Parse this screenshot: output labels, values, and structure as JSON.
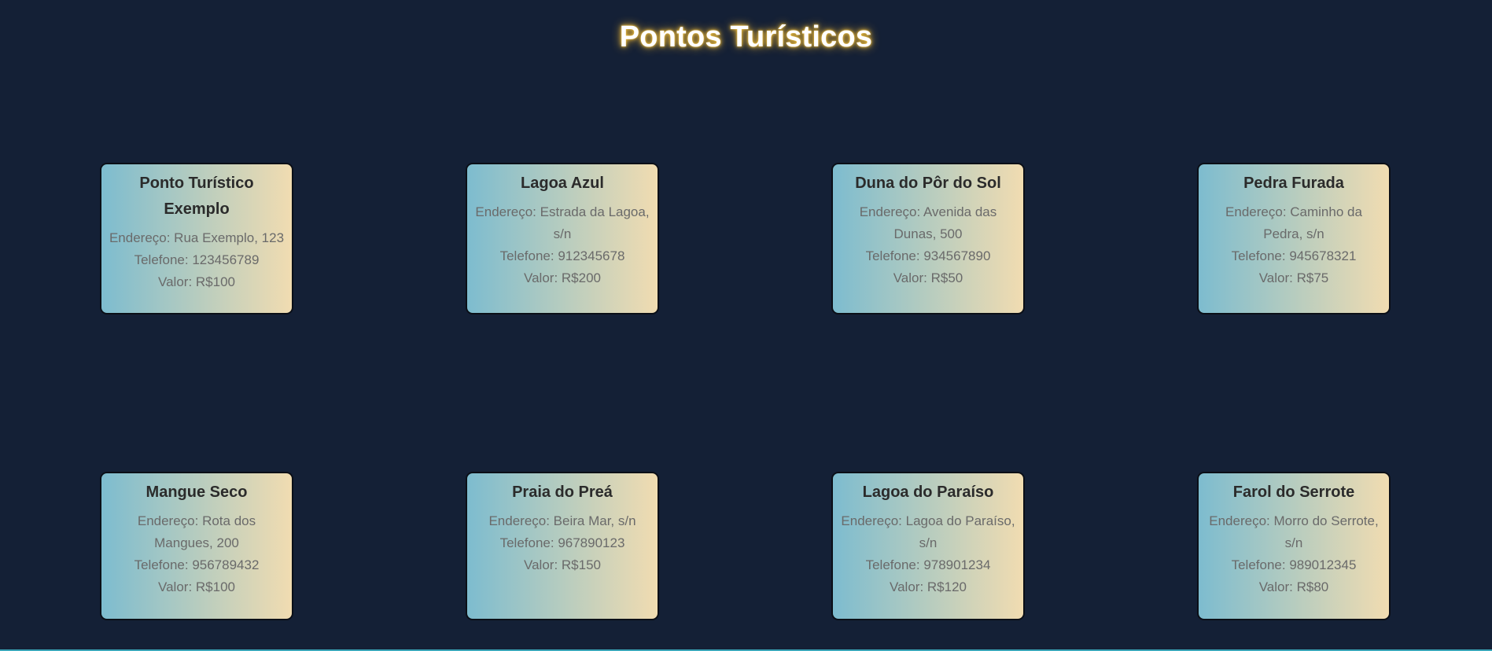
{
  "page": {
    "title": "Pontos Turísticos"
  },
  "cards": [
    {
      "name": "Ponto Turístico Exemplo",
      "address": "Endereço: Rua Exemplo, 123",
      "phone": "Telefone: 123456789",
      "price": "Valor: R$100"
    },
    {
      "name": "Lagoa Azul",
      "address": "Endereço: Estrada da Lagoa, s/n",
      "phone": "Telefone: 912345678",
      "price": "Valor: R$200"
    },
    {
      "name": "Duna do Pôr do Sol",
      "address": "Endereço: Avenida das Dunas, 500",
      "phone": "Telefone: 934567890",
      "price": "Valor: R$50"
    },
    {
      "name": "Pedra Furada",
      "address": "Endereço: Caminho da Pedra, s/n",
      "phone": "Telefone: 945678321",
      "price": "Valor: R$75"
    },
    {
      "name": "Mangue Seco",
      "address": "Endereço: Rota dos Mangues, 200",
      "phone": "Telefone: 956789432",
      "price": "Valor: R$100"
    },
    {
      "name": "Praia do Preá",
      "address": "Endereço: Beira Mar, s/n",
      "phone": "Telefone: 967890123",
      "price": "Valor: R$150"
    },
    {
      "name": "Lagoa do Paraíso",
      "address": "Endereço: Lagoa do Paraíso, s/n",
      "phone": "Telefone: 978901234",
      "price": "Valor: R$120"
    },
    {
      "name": "Farol do Serrote",
      "address": "Endereço: Morro do Serrote, s/n",
      "phone": "Telefone: 989012345",
      "price": "Valor: R$80"
    }
  ],
  "colors": {
    "background": "#142036",
    "card_gradient_start": "#7dbccf",
    "card_gradient_end": "#f1dcb1",
    "title_glow": "#f5c542"
  }
}
